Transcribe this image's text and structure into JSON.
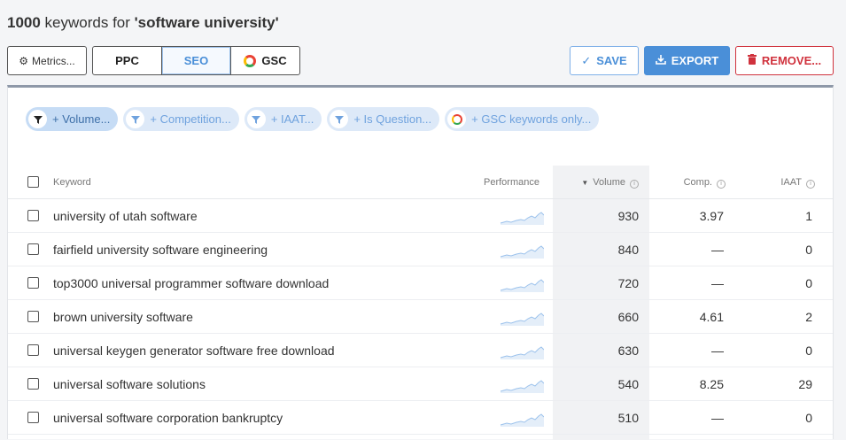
{
  "header": {
    "count": "1000",
    "middle": " keywords for ",
    "query": "'software university'"
  },
  "toolbar": {
    "metrics_label": "Metrics...",
    "tabs": [
      {
        "label": "PPC"
      },
      {
        "label": "SEO"
      },
      {
        "label": "GSC"
      }
    ],
    "active_tab": "SEO",
    "save_label": "SAVE",
    "export_label": "EXPORT",
    "remove_label": "REMOVE..."
  },
  "filters": [
    {
      "label": "+ Volume...",
      "icon": "filter-icon",
      "active": true
    },
    {
      "label": "+ Competition...",
      "icon": "filter-icon",
      "active": false
    },
    {
      "label": "+ IAAT...",
      "icon": "filter-icon",
      "active": false
    },
    {
      "label": "+ Is Question...",
      "icon": "filter-icon",
      "active": false
    },
    {
      "label": "+ GSC keywords only...",
      "icon": "google-icon",
      "active": false
    }
  ],
  "table": {
    "headers": {
      "keyword": "Keyword",
      "performance": "Performance",
      "volume": "Volume",
      "comp": "Comp.",
      "iaat": "IAAT"
    },
    "rows": [
      {
        "keyword": "university of utah software",
        "volume": "930",
        "comp": "3.97",
        "iaat": "1"
      },
      {
        "keyword": "fairfield university software engineering",
        "volume": "840",
        "comp": "—",
        "iaat": "0"
      },
      {
        "keyword": "top3000 universal programmer software download",
        "volume": "720",
        "comp": "—",
        "iaat": "0"
      },
      {
        "keyword": "brown university software",
        "volume": "660",
        "comp": "4.61",
        "iaat": "2"
      },
      {
        "keyword": "universal keygen generator software free download",
        "volume": "630",
        "comp": "—",
        "iaat": "0"
      },
      {
        "keyword": "universal software solutions",
        "volume": "540",
        "comp": "8.25",
        "iaat": "29"
      },
      {
        "keyword": "universal software corporation bankruptcy",
        "volume": "510",
        "comp": "—",
        "iaat": "0"
      }
    ]
  },
  "colors": {
    "accent": "#4a8fd8",
    "danger": "#d0323d",
    "chip_bg": "#dde9f8"
  }
}
